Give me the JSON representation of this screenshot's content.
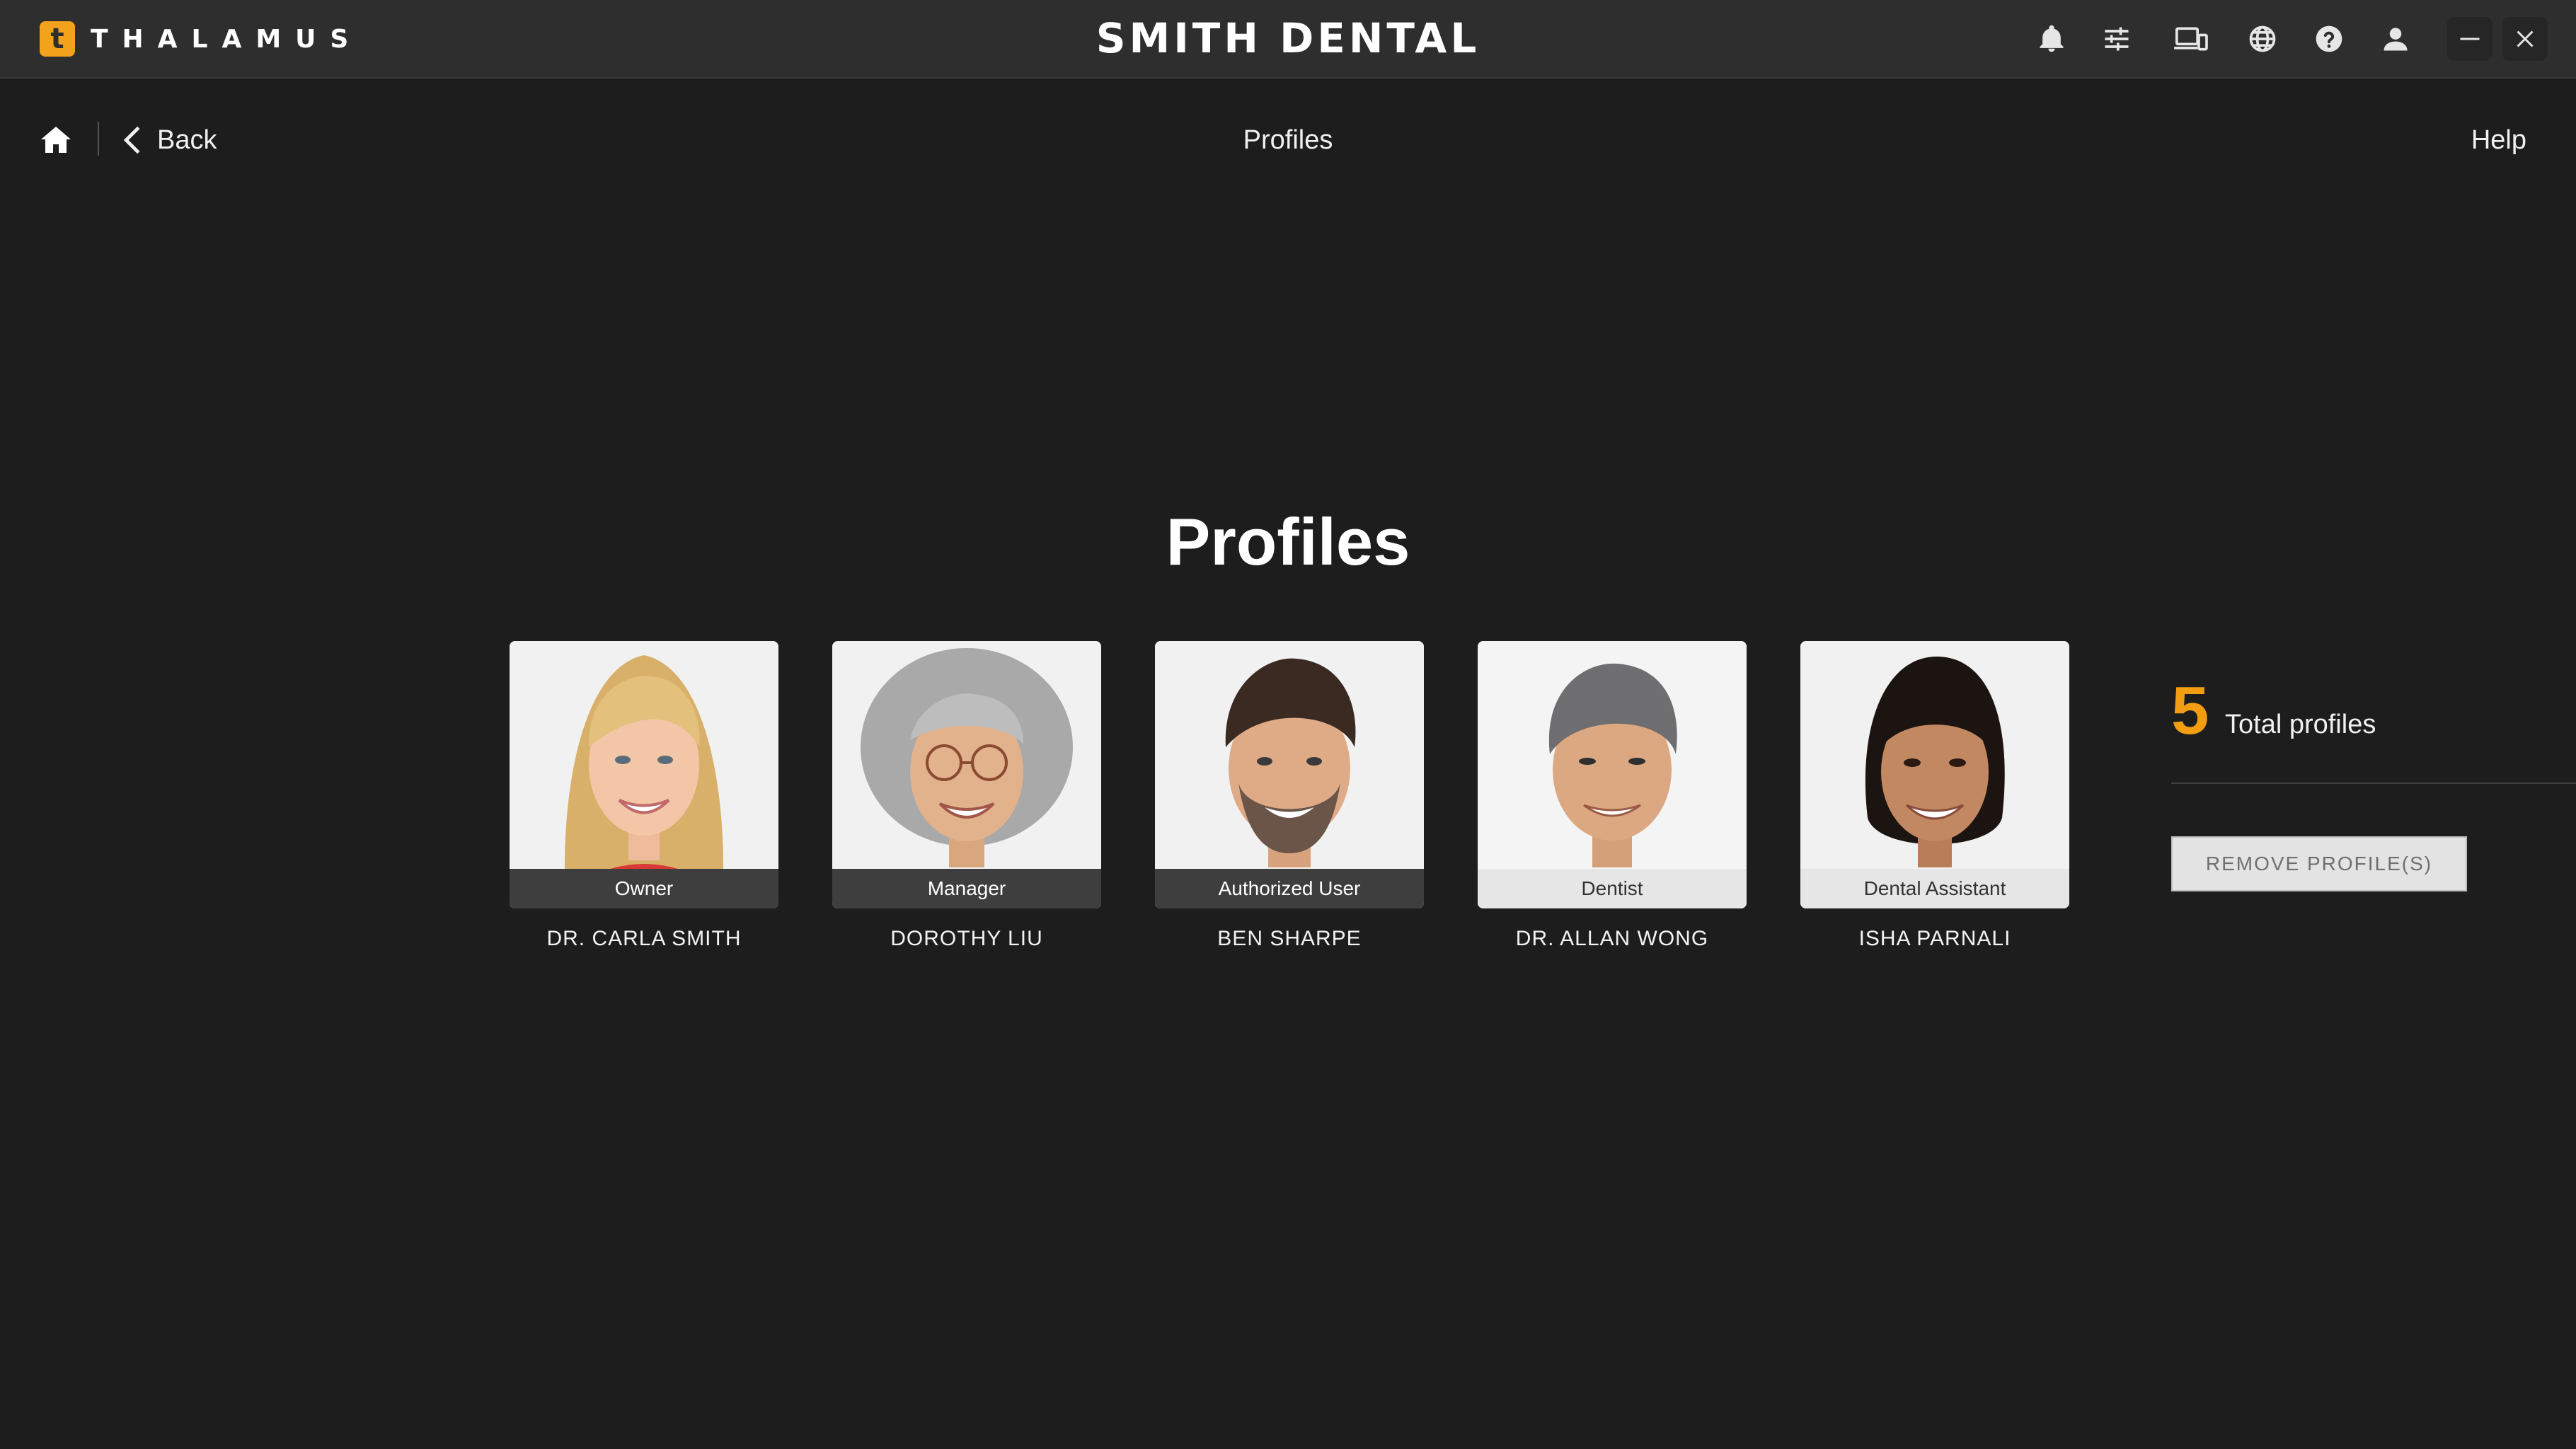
{
  "app": {
    "brand_letter": "t",
    "brand_name": "THALAMUS",
    "title": "SMITH DENTAL"
  },
  "toolbar_icons": [
    "bell-icon",
    "sliders-icon",
    "devices-icon",
    "globe-icon",
    "help-icon",
    "user-icon"
  ],
  "window_controls": [
    "minimize-icon",
    "close-icon"
  ],
  "nav": {
    "back_label": "Back",
    "page_title": "Profiles",
    "help_label": "Help"
  },
  "main": {
    "heading": "Profiles"
  },
  "profiles": [
    {
      "role": "Owner",
      "name": "DR. CARLA SMITH"
    },
    {
      "role": "Manager",
      "name": "DOROTHY LIU"
    },
    {
      "role": "Authorized User",
      "name": "BEN SHARPE"
    },
    {
      "role": "Dentist",
      "name": "DR. ALLAN WONG"
    },
    {
      "role": "Dental Assistant",
      "name": "ISHA PARNALI"
    }
  ],
  "summary": {
    "count": "5",
    "count_label": "Total profiles",
    "remove_button": "REMOVE PROFILE(S)"
  },
  "colors": {
    "accent": "#f29d12",
    "background": "#1d1d1d",
    "titlebar": "#2e2e2e"
  }
}
